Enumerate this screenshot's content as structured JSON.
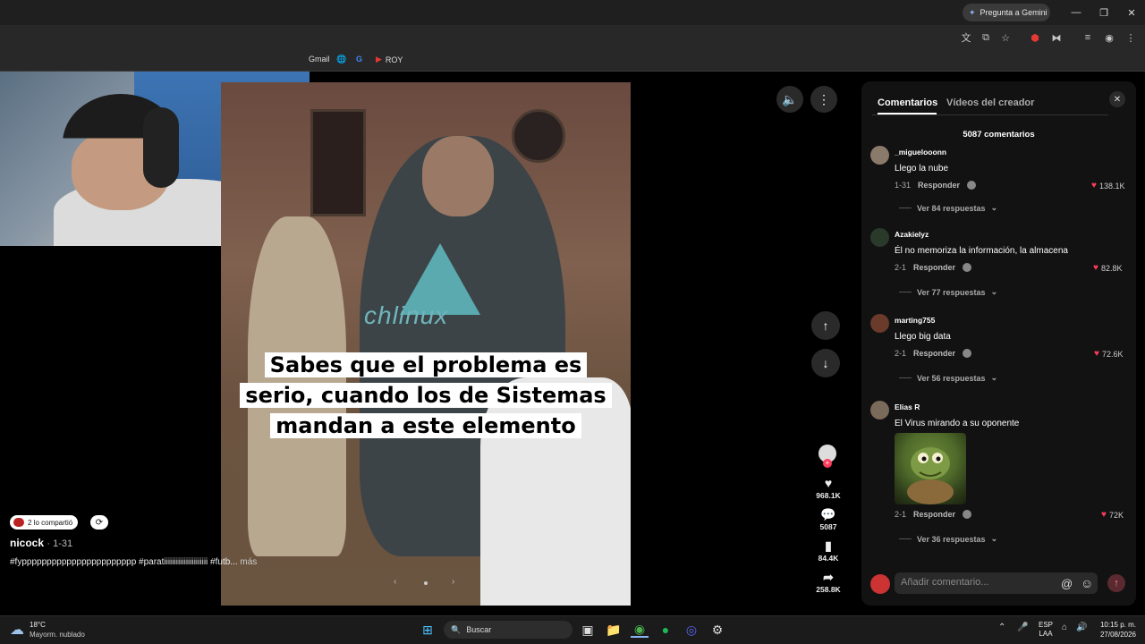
{
  "browser": {
    "gemini_label": "Pregunta a Gemini",
    "bookmarks": [
      "Gmail",
      "ROY"
    ]
  },
  "video": {
    "caption_lines": [
      "Sabes que el problema es",
      "serio, cuando los de Sistemas",
      "mandan a este elemento"
    ],
    "shirt_text": "chlinux",
    "shared_label": "2 lo compartió",
    "author": "nicock",
    "author_date": "· 1-31",
    "description": "#fyppppppppppppppppppppppp #paratiiiiiiiiiiiiiiiiiiiiii #futb...",
    "more_label": "más"
  },
  "actions": {
    "likes": "968.1K",
    "comments": "5087",
    "saves": "84.4K",
    "shares": "258.8K"
  },
  "panel": {
    "tabs": [
      "Comentarios",
      "Vídeos del creador"
    ],
    "count_label": "5087 comentarios",
    "reply_label": "Responder",
    "input_placeholder": "Añadir comentario...",
    "comments": [
      {
        "user": "_miguelooonn",
        "text": "Llego la nube",
        "date": "1-31",
        "likes": "138.1K",
        "replies": "Ver 84 respuestas"
      },
      {
        "user": "Azakielyz",
        "text": "Él no memoriza la información, la almacena",
        "date": "2-1",
        "likes": "82.8K",
        "replies": "Ver 77 respuestas"
      },
      {
        "user": "marting755",
        "text": "Llego big data",
        "date": "2-1",
        "likes": "72.6K",
        "replies": "Ver 56 respuestas"
      },
      {
        "user": "Elias R",
        "text": "El Virus mirando a su oponente",
        "date": "2-1",
        "likes": "72K",
        "replies": "Ver 36 respuestas"
      }
    ]
  },
  "taskbar": {
    "temp": "18°C",
    "weather": "Mayorm. nublado",
    "search": "Buscar",
    "lang1": "ESP",
    "lang2": "LAA",
    "time": "10:15 p. m.",
    "date": "27/08/2026"
  },
  "colors": {
    "like_heart": "#ff3b5c",
    "panel_bg": "#121212"
  }
}
